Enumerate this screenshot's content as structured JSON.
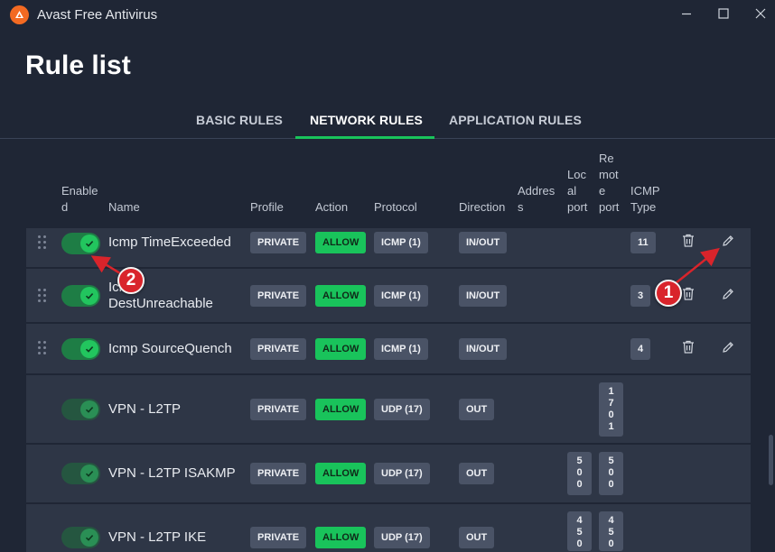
{
  "window": {
    "title": "Avast Free Antivirus"
  },
  "page": {
    "title": "Rule list"
  },
  "tabs": [
    {
      "label": "BASIC RULES",
      "active": false
    },
    {
      "label": "NETWORK RULES",
      "active": true
    },
    {
      "label": "APPLICATION RULES",
      "active": false
    }
  ],
  "columns": {
    "enabled": [
      "Enable",
      "d"
    ],
    "name": "Name",
    "profile": "Profile",
    "action": "Action",
    "protocol": "Protocol",
    "direction": "Direction",
    "address": [
      "Addres",
      "s"
    ],
    "local_port": [
      "Loc",
      "al",
      "port"
    ],
    "remote_port": [
      "Re",
      "mot",
      "e",
      "port"
    ],
    "icmp_type": [
      "ICMP",
      "Type"
    ]
  },
  "rows": [
    {
      "name": [
        "Icmp TimeExceeded"
      ],
      "profile": "PRIVATE",
      "action": "ALLOW",
      "protocol": "ICMP (1)",
      "direction": "IN/OUT",
      "icmp_type": "11",
      "enabled": true
    },
    {
      "name": [
        "Icmp",
        "DestUnreachable"
      ],
      "profile": "PRIVATE",
      "action": "ALLOW",
      "protocol": "ICMP (1)",
      "direction": "IN/OUT",
      "icmp_type": "3",
      "enabled": true
    },
    {
      "name": [
        "Icmp SourceQuench"
      ],
      "profile": "PRIVATE",
      "action": "ALLOW",
      "protocol": "ICMP (1)",
      "direction": "IN/OUT",
      "icmp_type": "4",
      "enabled": true
    },
    {
      "name": [
        "VPN - L2TP"
      ],
      "profile": "PRIVATE",
      "action": "ALLOW",
      "protocol": "UDP (17)",
      "direction": "OUT",
      "remote_port": [
        "1",
        "7",
        "0",
        "1"
      ],
      "enabled": true
    },
    {
      "name": [
        "VPN - L2TP ISAKMP"
      ],
      "profile": "PRIVATE",
      "action": "ALLOW",
      "protocol": "UDP (17)",
      "direction": "OUT",
      "local_port": [
        "5",
        "0",
        "0"
      ],
      "remote_port": [
        "5",
        "0",
        "0"
      ],
      "enabled": true
    },
    {
      "name": [
        "VPN - L2TP IKE"
      ],
      "profile": "PRIVATE",
      "action": "ALLOW",
      "protocol": "UDP (17)",
      "direction": "OUT",
      "local_port": [
        "4",
        "5",
        "0"
      ],
      "remote_port": [
        "4",
        "5",
        "0"
      ],
      "enabled": true
    }
  ],
  "annotations": [
    {
      "label": "1",
      "color": "#d9242b"
    },
    {
      "label": "2",
      "color": "#d9242b"
    }
  ],
  "colors": {
    "background": "#1f2635",
    "row": "#2e3646",
    "accent_green": "#19c35b",
    "chip": "#4a5366",
    "brand_orange": "#f36a22"
  },
  "icons": {
    "app": "avast-logo-icon",
    "minimize": "minimize-icon",
    "maximize": "maximize-icon",
    "close": "close-icon",
    "drag": "drag-handle-icon",
    "toggle_check": "check-icon",
    "delete": "trash-icon",
    "edit": "pencil-icon"
  }
}
